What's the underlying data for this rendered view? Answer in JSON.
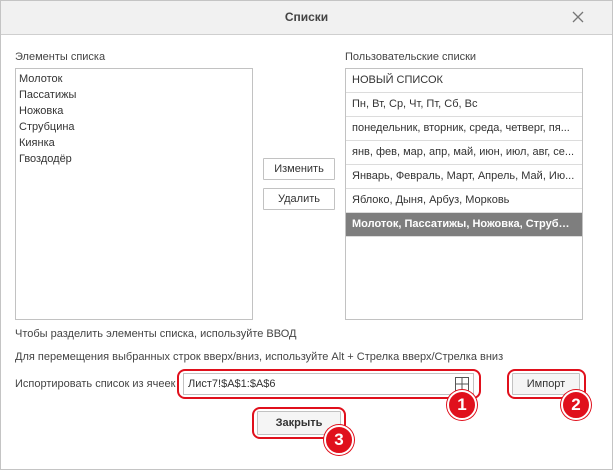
{
  "dialog": {
    "title": "Списки"
  },
  "left_panel": {
    "label": "Элементы списка",
    "items": [
      "Молоток",
      "Пассатижы",
      "Ножовка",
      "Струбцина",
      "Киянка",
      "Гвоздодёр"
    ]
  },
  "right_panel": {
    "label": "Пользовательские списки",
    "lists": [
      "НОВЫЙ СПИСОК",
      "Пн, Вт, Ср, Чт, Пт, Сб, Вс",
      "понедельник, вторник, среда, четверг, пя...",
      "янв, фев, мар, апр, май, июн, июл, авг, се...",
      "Январь, Февраль, Март, Апрель, Май, Ию...",
      "Яблоко, Дыня, Арбуз, Морковь",
      "Молоток, Пассатижы, Ножовка, Струбцин..."
    ],
    "selected_index": 6
  },
  "buttons": {
    "edit": "Изменить",
    "delete": "Удалить",
    "import": "Импорт",
    "close": "Закрыть"
  },
  "hints": {
    "separator": "Чтобы разделить элементы списка, используйте ВВОД",
    "reorder": "Для перемещения выбранных строк вверх/вниз, используйте Alt + Стрелка вверх/Стрелка вниз"
  },
  "import_row": {
    "label": "Испортировать список из ячеек",
    "range_value": "Лист7!$A$1:$A$6"
  },
  "annotations": {
    "badges": [
      "1",
      "2",
      "3"
    ],
    "accent_color": "#e0101c"
  },
  "icons": {
    "close": "close-icon",
    "range": "select-range-icon"
  }
}
